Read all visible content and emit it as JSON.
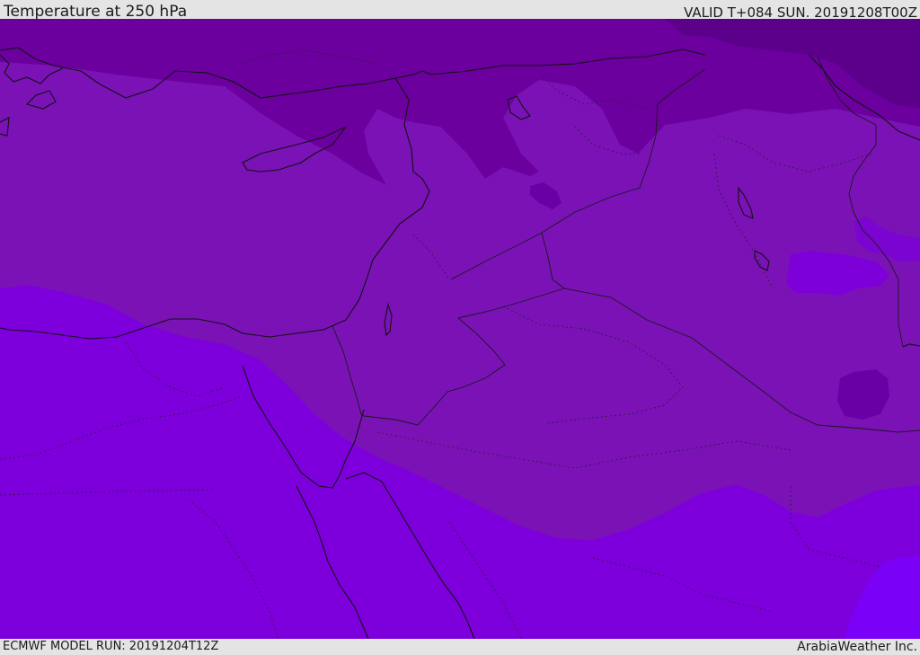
{
  "header": {
    "title": "Temperature at 250 hPa",
    "valid": "VALID T+084 SUN. 20191208T00Z"
  },
  "footer": {
    "model_run": "ECMWF MODEL RUN: 20191204T12Z",
    "credit": "ArabiaWeather Inc."
  },
  "map": {
    "colors": {
      "darkest": "#5a0088",
      "darker": "#6a009c",
      "mid": "#7c10b8",
      "upper_mid": "#7514b2",
      "lower": "#7e00dc",
      "lowest": "#7a00f6",
      "coast_line": "#111111",
      "border_line": "#222222"
    }
  }
}
